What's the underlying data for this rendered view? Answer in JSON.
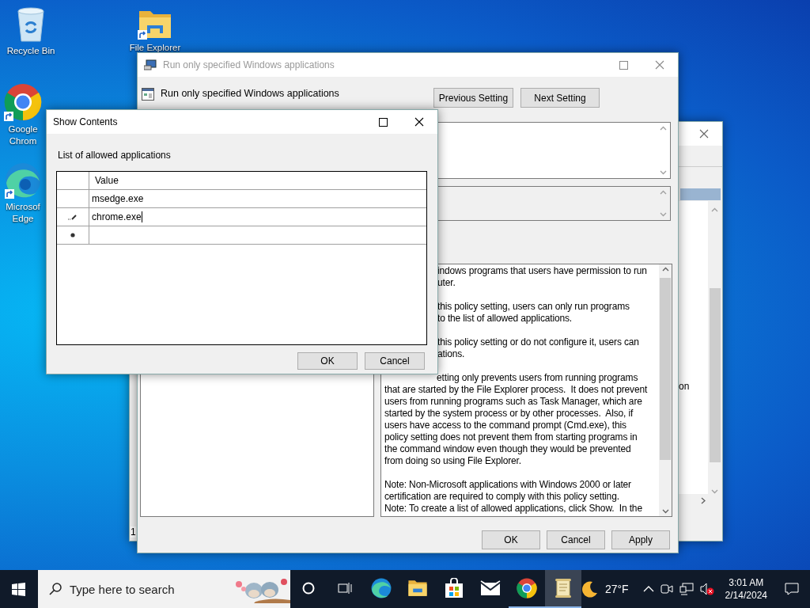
{
  "desktop_icons": [
    {
      "kind": "trash",
      "label_lines": [
        "Recycle Bin"
      ],
      "shortcut": false
    },
    {
      "kind": "folder",
      "label_lines": [
        "File Explorer"
      ],
      "shortcut": true
    },
    {
      "kind": "ring",
      "label_lines": [
        "Google",
        "Chrom"
      ],
      "shortcut": true
    },
    {
      "kind": "wave",
      "label_lines": [
        "Microsof",
        "Edge"
      ],
      "shortcut": true
    }
  ],
  "back_window": {
    "cut_texts": [
      "on",
      "1"
    ]
  },
  "policy_window": {
    "title": "Run only specified Windows applications",
    "active": false,
    "heading": "Run only specified Windows applications",
    "nav_buttons": [
      "Previous Setting",
      "Next Setting"
    ],
    "help_paragraphs": [
      {
        "kind": "covered",
        "text": "indows programs that users have permission to run\nuter."
      },
      {
        "kind": "covered",
        "text": "this policy setting, users can only run programs\nto the list of allowed applications."
      },
      {
        "kind": "covered",
        "text": "this policy setting or do not configure it, users can\nations."
      },
      {
        "kind": "first-line-covered",
        "text": "etting only prevents users from running programs\nthat are started by the File Explorer process.  It does not prevent\nusers from running programs such as Task Manager, which are\nstarted by the system process or by other processes.  Also, if\nusers have access to the command prompt (Cmd.exe), this\npolicy setting does not prevent them from starting programs in\nthe command window even though they would be prevented\nfrom doing so using File Explorer."
      },
      {
        "kind": "full",
        "text": "Note: Non-Microsoft applications with Windows 2000 or later\ncertification are required to comply with this policy setting.\nNote: To create a list of allowed applications, click Show.  In the"
      }
    ],
    "buttons": [
      "OK",
      "Cancel",
      "Apply"
    ]
  },
  "dialog": {
    "title": "Show Contents",
    "active": true,
    "label": "List of allowed applications",
    "column": "Value",
    "rows": [
      {
        "value": "msedge.exe",
        "editing": false
      },
      {
        "value": "chrome.exe",
        "editing": true
      }
    ],
    "buttons": [
      "OK",
      "Cancel"
    ]
  },
  "taskbar": {
    "search_placeholder": "Type here to search",
    "apps": [
      {
        "kind": "wave",
        "running": false,
        "active": false
      },
      {
        "kind": "folder",
        "running": false,
        "active": false
      },
      {
        "kind": "bag",
        "running": false,
        "active": false
      },
      {
        "kind": "envelope",
        "running": false,
        "active": false
      },
      {
        "kind": "ring",
        "running": true,
        "active": false
      },
      {
        "kind": "scroll",
        "running": true,
        "active": true
      }
    ],
    "weather": "27°F",
    "volume_muted": true,
    "time": "3:01 AM",
    "date": "2/14/2024"
  }
}
